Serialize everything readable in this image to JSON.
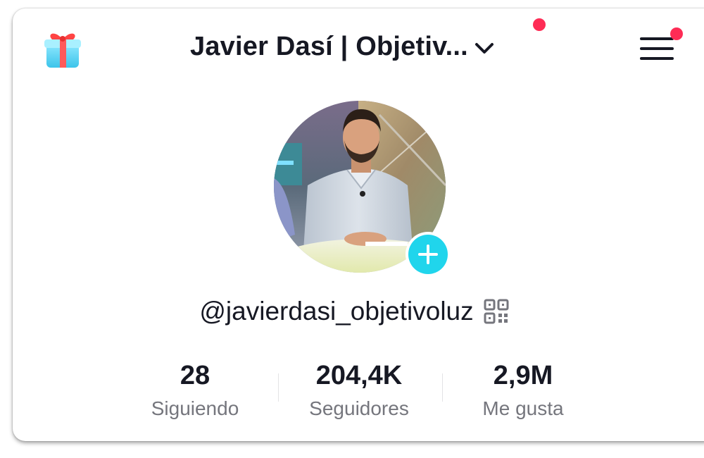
{
  "header": {
    "title": "Javier Dasí | Objetiv...",
    "gift_icon": "gift-box-icon",
    "dropdown_icon": "chevron-down-icon",
    "menu_icon": "hamburger-menu-icon",
    "notification_color": "#fe2c55"
  },
  "profile": {
    "avatar_icon": "profile-photo",
    "follow_icon": "plus-icon",
    "follow_color": "#20d5ec",
    "username": "@javierdasi_objetivoluz",
    "qr_icon": "qr-code-icon"
  },
  "stats": [
    {
      "value": "28",
      "label": "Siguiendo"
    },
    {
      "value": "204,4K",
      "label": "Seguidores"
    },
    {
      "value": "2,9M",
      "label": "Me gusta"
    }
  ]
}
